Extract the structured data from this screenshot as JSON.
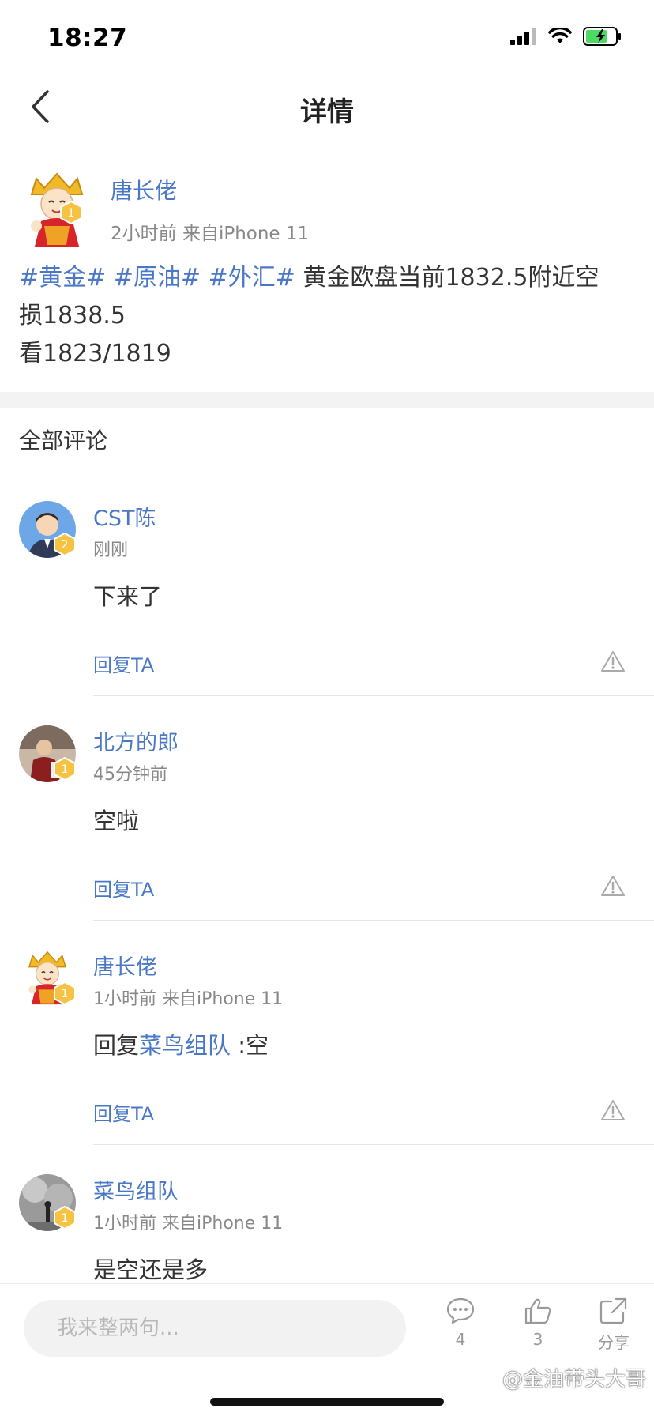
{
  "status_bar": {
    "time": "18:27"
  },
  "nav": {
    "title": "详情"
  },
  "post": {
    "author": "唐长佬",
    "meta": "2小时前  来自iPhone 11",
    "badge_level": "1",
    "tags": [
      "#黄金#",
      "#原油#",
      "#外汇#"
    ],
    "text_line1": " 黄金欧盘当前1832.5附近空",
    "text_line2": "损1838.5",
    "text_line3": "看1823/1819"
  },
  "comments_section": {
    "title": "全部评论"
  },
  "comments": [
    {
      "name": "CST陈",
      "time": "刚刚",
      "badge": "2",
      "text": "下来了",
      "reply_label": "回复TA"
    },
    {
      "name": "北方的郎",
      "time": "45分钟前",
      "badge": "1",
      "text": "空啦",
      "reply_label": "回复TA"
    },
    {
      "name": "唐长佬",
      "time": "1小时前  来自iPhone 11",
      "badge": "1",
      "text_prefix": "回复",
      "text_link": "菜鸟组队",
      "text_suffix": " :空",
      "reply_label": "回复TA"
    },
    {
      "name": "菜鸟组队",
      "time": "1小时前  来自iPhone 11",
      "badge": "1",
      "text": "是空还是多"
    }
  ],
  "bottom_bar": {
    "input_placeholder": "我来整两句...",
    "comment_count": "4",
    "like_count": "3",
    "share_label": "分享",
    "watermark": "@金油带头大哥"
  },
  "colors": {
    "link": "#4a78c6",
    "badge": "#f5c242",
    "battery": "#4cd964"
  },
  "icons": [
    "back-icon",
    "signal-icon",
    "wifi-icon",
    "battery-icon",
    "warning-icon",
    "comment-icon",
    "like-icon",
    "share-icon"
  ]
}
